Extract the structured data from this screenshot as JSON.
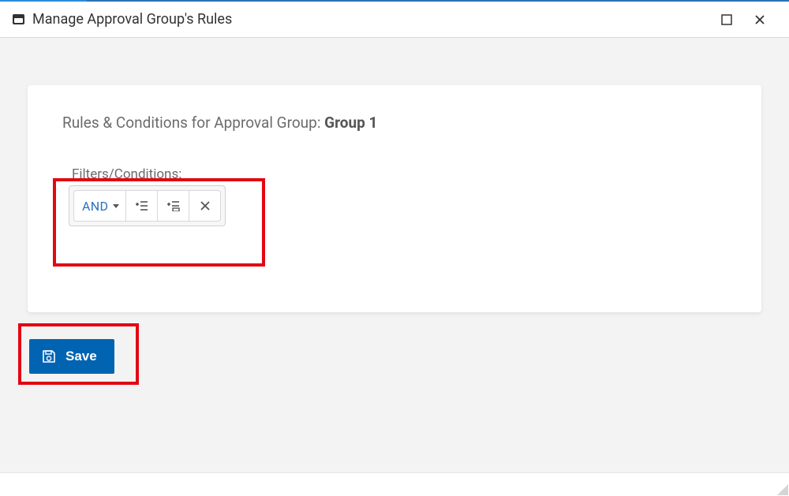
{
  "window": {
    "title": "Manage Approval Group's Rules"
  },
  "heading": {
    "prefix": "Rules & Conditions for Approval Group: ",
    "group_name": "Group 1"
  },
  "filters": {
    "label": "Filters/Conditions:",
    "operator": "AND"
  },
  "actions": {
    "save_label": "Save"
  }
}
